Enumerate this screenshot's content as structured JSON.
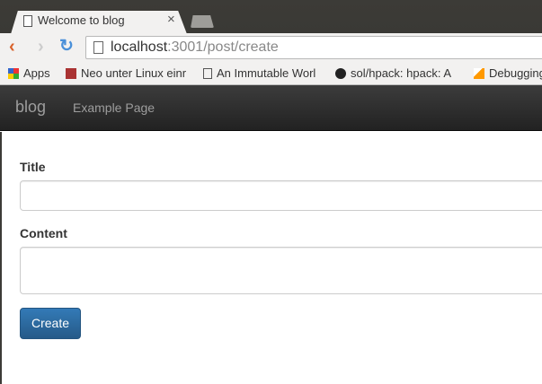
{
  "browser": {
    "tab_title": "Welcome to blog",
    "url_host": "localhost",
    "url_rest": ":3001/post/create",
    "bookmarks": [
      "Apps",
      "Neo unter Linux einr",
      "An Immutable Worl",
      "sol/hpack: hpack: A",
      "Debugging"
    ]
  },
  "navbar": {
    "brand": "blog",
    "links": [
      "Example Page"
    ]
  },
  "form": {
    "title_label": "Title",
    "title_value": "",
    "content_label": "Content",
    "content_value": "",
    "submit_label": "Create"
  },
  "colors": {
    "primary": "#2e6da4",
    "navbar": "#222222"
  }
}
